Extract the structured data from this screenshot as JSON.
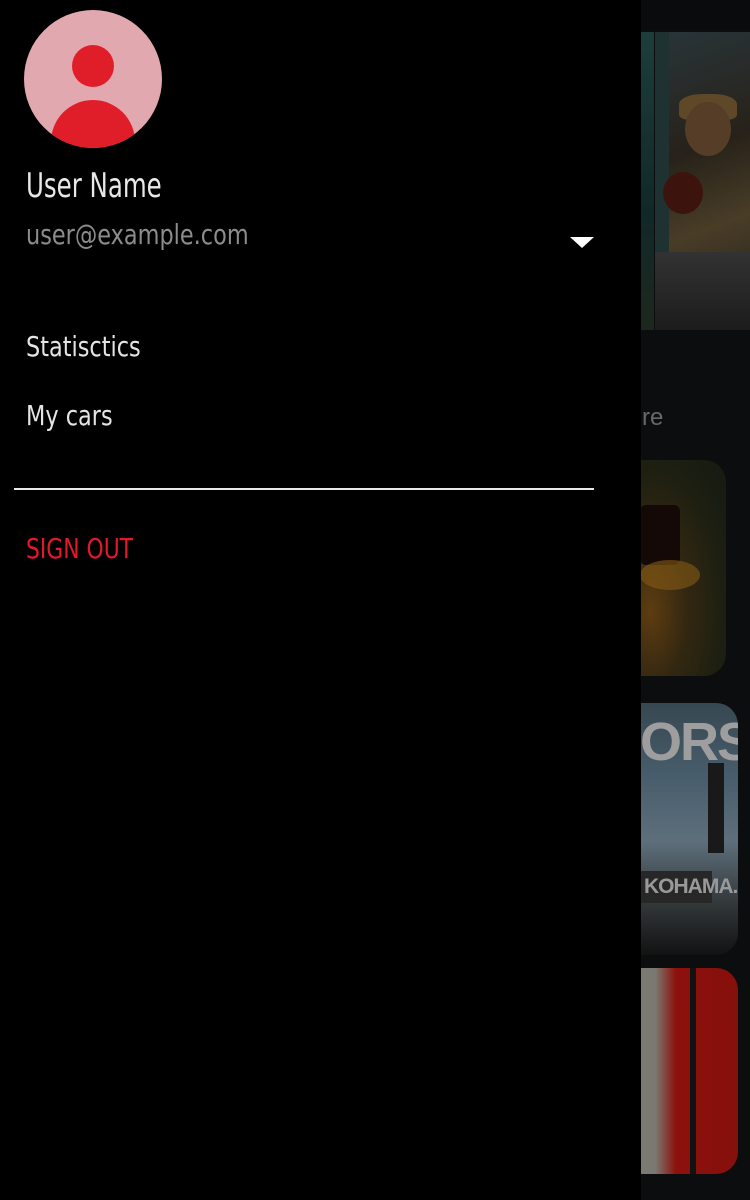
{
  "drawer": {
    "user": {
      "name": "User Name",
      "email": "user@example.com"
    },
    "menu": [
      {
        "label": "Statisctics"
      },
      {
        "label": "My cars"
      }
    ],
    "sign_out_label": "SIGN OUT"
  },
  "background": {
    "partial_text": "re",
    "card2_text": "ORS",
    "card2_banner": "KOHAMA."
  },
  "colors": {
    "accent": "#e4182a",
    "avatar_bg": "#e2a8b0",
    "drawer_bg": "#000000"
  },
  "icons": {
    "avatar": "person-icon",
    "account_toggle": "caret-down-icon"
  }
}
